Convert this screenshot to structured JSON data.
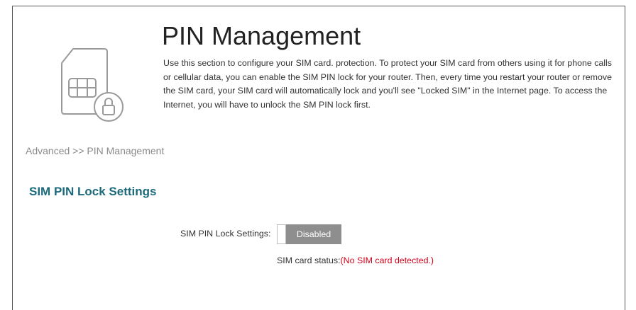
{
  "header": {
    "title": "PIN Management",
    "description": "Use this section to configure your SIM card. protection. To protect your SIM card from others using it for phone calls or cellular data, you can enable the SIM PIN lock for your router. Then, every time you restart your router or remove the SIM card, your SIM card will automatically lock and you'll see \"Locked SIM\" in the Internet page. To access the Internet, you will have to unlock the SM PIN lock first."
  },
  "breadcrumb": "Advanced >> PIN Management",
  "section": {
    "title": "SIM PIN Lock Settings"
  },
  "form": {
    "lock_label": "SIM PIN Lock Settings:",
    "lock_state": "Disabled",
    "status_label": "SIM card status:",
    "status_value": "(No SIM card detected.)"
  },
  "icons": {
    "page_icon": "sim-card-lock-icon"
  },
  "colors": {
    "section_title": "#1c6a7c",
    "toggle_disabled": "#8e8e8e",
    "status_error": "#d0021b"
  }
}
